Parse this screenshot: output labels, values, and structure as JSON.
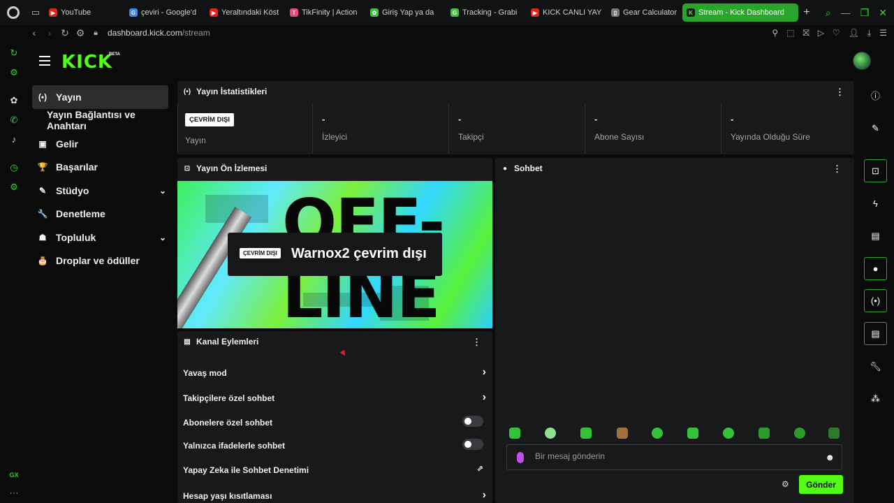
{
  "browser": {
    "tabs": [
      {
        "label": "YouTube",
        "color": "#e62117",
        "glyph": "▶"
      },
      {
        "label": "çeviri - Google'd",
        "color": "#4285f4",
        "glyph": "G"
      },
      {
        "label": "Yeraltındaki Köst",
        "color": "#e62117",
        "glyph": "▶"
      },
      {
        "label": "TikFinity | Action",
        "color": "#e84a7a",
        "glyph": "T"
      },
      {
        "label": "Giriş Yap ya da",
        "color": "#3cc43c",
        "glyph": "✿"
      },
      {
        "label": "Tracking - Grabi",
        "color": "#3cc43c",
        "glyph": "G"
      },
      {
        "label": "KICK CANLI YAY",
        "color": "#e62117",
        "glyph": "▶"
      },
      {
        "label": "Gear Calculator",
        "color": "#777777",
        "glyph": "▯"
      }
    ],
    "active_tab": "Stream - Kick Dashboard",
    "url_host": "dashboard.kick.com",
    "url_path": "/stream"
  },
  "header": {
    "logo": "KICK",
    "beta": "BETA"
  },
  "nav": {
    "items": [
      {
        "label": "Yayın",
        "icon": "broadcast-icon",
        "glyph": "(•)"
      },
      {
        "label": "Yayın Bağlantısı ve Anahtarı",
        "icon": "",
        "glyph": ""
      },
      {
        "label": "Gelir",
        "icon": "money-icon",
        "glyph": "▣"
      },
      {
        "label": "Başarılar",
        "icon": "trophy-icon",
        "glyph": "🏆"
      },
      {
        "label": "Stüdyo",
        "icon": "palette-icon",
        "glyph": "✎"
      },
      {
        "label": "Denetleme",
        "icon": "wrench-icon",
        "glyph": "🔧"
      },
      {
        "label": "Topluluk",
        "icon": "community-icon",
        "glyph": "☗"
      },
      {
        "label": "Droplar ve ödüller",
        "icon": "gift-icon",
        "glyph": "🎂"
      }
    ]
  },
  "stats": {
    "title": "Yayın İstatistikleri",
    "status_badge": "ÇEVRİM DIŞI",
    "items": [
      {
        "value": "",
        "label": "Yayın"
      },
      {
        "value": "-",
        "label": "İzleyici"
      },
      {
        "value": "-",
        "label": "Takipçi"
      },
      {
        "value": "-",
        "label": "Abone Sayısı"
      },
      {
        "value": "-",
        "label": "Yayında Olduğu Süre"
      }
    ]
  },
  "preview": {
    "title": "Yayın Ön İzlemesi",
    "bg_text": "OFF-\nLINE",
    "badge": "ÇEVRİM DIŞI",
    "message": "Warnox2 çevrim dışı"
  },
  "actions": {
    "title": "Kanal Eylemleri",
    "rows": [
      {
        "label": "Yavaş mod",
        "control": "arrow"
      },
      {
        "label": "Takipçilere özel sohbet",
        "control": "arrow"
      },
      {
        "label": "Abonelere özel sohbet",
        "control": "toggle"
      },
      {
        "label": "Yalnızca ifadelerle sohbet",
        "control": "toggle"
      },
      {
        "label": "Yapay Zeka ile Sohbet Denetimi",
        "control": "external"
      },
      {
        "label": "Hesap yaşı kısıtlaması",
        "control": "arrow"
      }
    ]
  },
  "chat": {
    "title": "Sohbet",
    "placeholder": "Bir mesaj gönderin",
    "send_label": "Gönder"
  },
  "opera_sidebar": {
    "gx_label": "GX"
  },
  "colors": {
    "kick_green": "#53fc18",
    "active_tab": "#2ba42b",
    "panel": "#18191b"
  }
}
